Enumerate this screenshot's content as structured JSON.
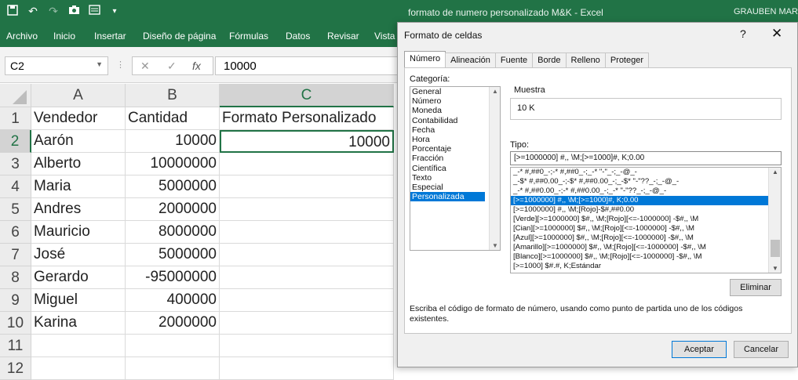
{
  "window": {
    "title": "formato de numero personalizado M&K  -  Excel",
    "user": "GRAUBEN MARTÍNEZ"
  },
  "qat_icons": [
    "save-icon",
    "undo-icon",
    "redo-icon",
    "camera-icon",
    "form-icon",
    "customize-qat-icon"
  ],
  "ribbon": {
    "tabs": [
      "Archivo",
      "Inicio",
      "Insertar",
      "Diseño de página",
      "Fórmulas",
      "Datos",
      "Revisar",
      "Vista"
    ]
  },
  "formula_bar": {
    "name_box": "C2",
    "cancel": "✕",
    "enter": "✓",
    "fx": "fx",
    "value": "10000"
  },
  "sheet": {
    "columns": [
      "A",
      "B",
      "C"
    ],
    "rows": [
      {
        "n": "1",
        "a": "Vendedor",
        "b": "Cantidad",
        "c": "Formato Personalizado"
      },
      {
        "n": "2",
        "a": "Aarón",
        "b": "10000",
        "c": "10000"
      },
      {
        "n": "3",
        "a": "Alberto",
        "b": "10000000",
        "c": ""
      },
      {
        "n": "4",
        "a": "Maria",
        "b": "5000000",
        "c": ""
      },
      {
        "n": "5",
        "a": "Andres",
        "b": "2000000",
        "c": ""
      },
      {
        "n": "6",
        "a": "Mauricio",
        "b": "8000000",
        "c": ""
      },
      {
        "n": "7",
        "a": "José",
        "b": "5000000",
        "c": ""
      },
      {
        "n": "8",
        "a": "Gerardo",
        "b": "-95000000",
        "c": ""
      },
      {
        "n": "9",
        "a": "Miguel",
        "b": "400000",
        "c": ""
      },
      {
        "n": "10",
        "a": "Karina",
        "b": "2000000",
        "c": ""
      },
      {
        "n": "11",
        "a": "",
        "b": "",
        "c": ""
      },
      {
        "n": "12",
        "a": "",
        "b": "",
        "c": ""
      }
    ]
  },
  "dialog": {
    "title": "Formato de celdas",
    "help": "?",
    "close": "✕",
    "tabs": [
      "Número",
      "Alineación",
      "Fuente",
      "Borde",
      "Relleno",
      "Proteger"
    ],
    "categoria_label": "Categoría:",
    "categories": [
      "General",
      "Número",
      "Moneda",
      "Contabilidad",
      "Fecha",
      "Hora",
      "Porcentaje",
      "Fracción",
      "Científica",
      "Texto",
      "Especial",
      "Personalizada"
    ],
    "selected_category": "Personalizada",
    "muestra_label": "Muestra",
    "muestra_value": "10 K",
    "tipo_label": "Tipo:",
    "tipo_value": "[>=1000000] #,, \\M;[>=1000]#, K;0.00",
    "formats": [
      "_-* #,##0_-;-* #,##0_-;_-* \"-\"_-;_-@_-",
      "_-$* #,##0.00_-;-$* #,##0.00_-;_-$* \"-\"??_-;_-@_-",
      "_-* #,##0.00_-;-* #,##0.00_-;_-* \"-\"??_-;_-@_-",
      "[>=1000000] #,, \\M;[>=1000]#, K;0.00",
      "[>=1000000] #,, \\M;[Rojo]-$#,##0.00",
      "[Verde][>=1000000] $#,, \\M;[Rojo][<=-1000000] -$#,, \\M",
      "[Cian][>=1000000] $#,, \\M;[Rojo][<=-1000000] -$#,, \\M",
      "[Azul][>=1000000] $#,, \\M;[Rojo][<=-1000000] -$#,, \\M",
      "[Amarillo][>=1000000] $#,, \\M;[Rojo][<=-1000000] -$#,, \\M",
      "[Blanco][>=1000000] $#,, \\M;[Rojo][<=-1000000] -$#,, \\M",
      "[>=1000] $#.#, K;Estándar"
    ],
    "selected_format_index": 3,
    "eliminar": "Eliminar",
    "description": "Escriba el código de formato de número, usando como punto de partida uno de los códigos existentes.",
    "aceptar": "Aceptar",
    "cancelar": "Cancelar"
  }
}
